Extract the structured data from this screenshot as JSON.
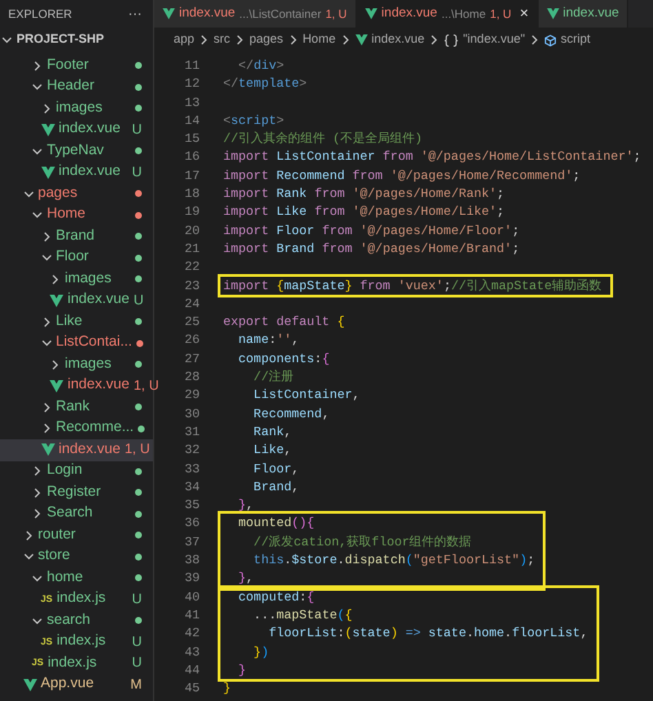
{
  "sidebar": {
    "title": "EXPLORER",
    "more": "···",
    "project": {
      "name": "PROJECT-SHP",
      "expanded": true
    }
  },
  "tree": {
    "cut_children": [
      {
        "name": "Footer",
        "kind": "folder",
        "expanded": false,
        "color": "#73c991",
        "selected": false
      },
      {
        "name": "Header",
        "kind": "folder",
        "expanded": true,
        "color": "#73c991",
        "selected": false,
        "children": [
          {
            "name": "images",
            "kind": "folder",
            "expanded": false,
            "color": "#73c991",
            "selected": false
          },
          {
            "name": "index.vue",
            "kind": "vue",
            "badge": "U",
            "color": "#73c991",
            "selected": false
          }
        ]
      },
      {
        "name": "TypeNav",
        "kind": "folder",
        "expanded": true,
        "color": "#73c991",
        "selected": false,
        "children": [
          {
            "name": "index.vue",
            "kind": "vue",
            "badge": "U",
            "color": "#73c991",
            "selected": false
          }
        ]
      }
    ],
    "items": [
      {
        "name": "pages",
        "kind": "folder",
        "expanded": true,
        "color": "#f07b6e",
        "selected": false,
        "children": [
          {
            "name": "Home",
            "kind": "folder",
            "expanded": true,
            "color": "#f07b6e",
            "selected": false,
            "children": [
              {
                "name": "Brand",
                "kind": "folder",
                "expanded": false,
                "color": "#73c991",
                "selected": false
              },
              {
                "name": "Floor",
                "kind": "folder",
                "expanded": true,
                "color": "#73c991",
                "selected": false,
                "children": [
                  {
                    "name": "images",
                    "kind": "folder",
                    "expanded": false,
                    "color": "#73c991",
                    "selected": false
                  },
                  {
                    "name": "index.vue",
                    "kind": "vue",
                    "badge": "U",
                    "color": "#73c991",
                    "selected": false
                  }
                ]
              },
              {
                "name": "Like",
                "kind": "folder",
                "expanded": false,
                "color": "#73c991",
                "selected": false
              },
              {
                "name": "ListContai...",
                "kind": "folder",
                "expanded": true,
                "color": "#f07b6e",
                "selected": false,
                "children": [
                  {
                    "name": "images",
                    "kind": "folder",
                    "expanded": false,
                    "color": "#73c991",
                    "selected": false
                  },
                  {
                    "name": "index.vue",
                    "kind": "vue",
                    "badge": "1, U",
                    "color": "#f07b6e",
                    "selected": false
                  }
                ]
              },
              {
                "name": "Rank",
                "kind": "folder",
                "expanded": false,
                "color": "#73c991",
                "selected": false
              },
              {
                "name": "Recomme...",
                "kind": "folder",
                "expanded": false,
                "color": "#73c991",
                "selected": false
              },
              {
                "name": "index.vue",
                "kind": "vue",
                "badge": "1, U",
                "color": "#f07b6e",
                "selected": true
              }
            ]
          },
          {
            "name": "Login",
            "kind": "folder",
            "expanded": false,
            "color": "#73c991",
            "selected": false
          },
          {
            "name": "Register",
            "kind": "folder",
            "expanded": false,
            "color": "#73c991",
            "selected": false
          },
          {
            "name": "Search",
            "kind": "folder",
            "expanded": false,
            "color": "#73c991",
            "selected": false
          }
        ]
      },
      {
        "name": "router",
        "kind": "folder",
        "expanded": false,
        "color": "#73c991",
        "selected": false
      },
      {
        "name": "store",
        "kind": "folder",
        "expanded": true,
        "color": "#73c991",
        "selected": false,
        "children": [
          {
            "name": "home",
            "kind": "folder",
            "expanded": true,
            "color": "#73c991",
            "selected": false,
            "children": [
              {
                "name": "index.js",
                "kind": "js",
                "icon_label": "JS",
                "badge": "U",
                "color": "#73c991",
                "selected": false
              }
            ]
          },
          {
            "name": "search",
            "kind": "folder",
            "expanded": true,
            "color": "#73c991",
            "selected": false,
            "children": [
              {
                "name": "index.js",
                "kind": "js",
                "icon_label": "JS",
                "badge": "U",
                "color": "#73c991",
                "selected": false
              }
            ]
          },
          {
            "name": "index.js",
            "kind": "js",
            "icon_label": "JS",
            "badge": "U",
            "color": "#73c991",
            "selected": false
          }
        ]
      },
      {
        "name": "App.vue",
        "kind": "vue",
        "badge": "M",
        "color": "#e2c08d",
        "selected": false
      }
    ]
  },
  "tabs": [
    {
      "filename": "index.vue",
      "path": "...\\ListContainer",
      "badge": "1, U",
      "color": "#f07b6e",
      "selected": false
    },
    {
      "filename": "index.vue",
      "path": "...\\Home",
      "badge": "1, U",
      "color": "#f07b6e",
      "selected": true,
      "close": "×"
    },
    {
      "filename": "index.vue",
      "color": "#73c991",
      "selected": false
    }
  ],
  "breadcrumb": [
    {
      "label": "app",
      "kind": "text"
    },
    {
      "label": "src",
      "kind": "text"
    },
    {
      "label": "pages",
      "kind": "text"
    },
    {
      "label": "Home",
      "kind": "text"
    },
    {
      "label": "index.vue",
      "kind": "vue"
    },
    {
      "label": "\"index.vue\"",
      "kind": "braces"
    },
    {
      "label": "script",
      "kind": "symbol"
    }
  ],
  "code": [
    {
      "boxed": false,
      "lines": [
        {
          "n": "11",
          "tokens": [
            {
              "t": "  </",
              "kind": "g"
            },
            {
              "t": "div",
              "kind": "tg"
            },
            {
              "t": ">",
              "kind": "g"
            }
          ]
        },
        {
          "n": "12",
          "tokens": [
            {
              "t": "</",
              "kind": "g"
            },
            {
              "t": "template",
              "kind": "tg"
            },
            {
              "t": ">",
              "kind": "g"
            }
          ]
        },
        {
          "n": "13"
        },
        {
          "n": "14",
          "tokens": [
            {
              "t": "<",
              "kind": "g"
            },
            {
              "t": "script",
              "kind": "tg"
            },
            {
              "t": ">",
              "kind": "g"
            }
          ]
        },
        {
          "n": "15",
          "tokens": [
            {
              "t": "//引入其余的组件 (不是全局组件)",
              "kind": "c"
            }
          ]
        },
        {
          "n": "16",
          "tokens": [
            {
              "t": "import",
              "kind": "k"
            },
            {
              "t": " ListContainer ",
              "kind": "v"
            },
            {
              "t": "from",
              "kind": "k"
            },
            {
              "t": " '@/pages/Home/ListContainer'",
              "kind": "s"
            },
            {
              "t": ";",
              "kind": "p"
            }
          ]
        },
        {
          "n": "17",
          "tokens": [
            {
              "t": "import",
              "kind": "k"
            },
            {
              "t": " Recommend ",
              "kind": "v"
            },
            {
              "t": "from",
              "kind": "k"
            },
            {
              "t": " '@/pages/Home/Recommend'",
              "kind": "s"
            },
            {
              "t": ";",
              "kind": "p"
            }
          ]
        },
        {
          "n": "18",
          "tokens": [
            {
              "t": "import",
              "kind": "k"
            },
            {
              "t": " Rank ",
              "kind": "v"
            },
            {
              "t": "from",
              "kind": "k"
            },
            {
              "t": " '@/pages/Home/Rank'",
              "kind": "s"
            },
            {
              "t": ";",
              "kind": "p"
            }
          ]
        },
        {
          "n": "19",
          "tokens": [
            {
              "t": "import",
              "kind": "k"
            },
            {
              "t": " Like ",
              "kind": "v"
            },
            {
              "t": "from",
              "kind": "k"
            },
            {
              "t": " '@/pages/Home/Like'",
              "kind": "s"
            },
            {
              "t": ";",
              "kind": "p"
            }
          ]
        },
        {
          "n": "20",
          "tokens": [
            {
              "t": "import",
              "kind": "k"
            },
            {
              "t": " Floor ",
              "kind": "v"
            },
            {
              "t": "from",
              "kind": "k"
            },
            {
              "t": " '@/pages/Home/Floor'",
              "kind": "s"
            },
            {
              "t": ";",
              "kind": "p"
            }
          ]
        },
        {
          "n": "21",
          "tokens": [
            {
              "t": "import",
              "kind": "k"
            },
            {
              "t": " Brand ",
              "kind": "v"
            },
            {
              "t": "from",
              "kind": "k"
            },
            {
              "t": " '@/pages/Home/Brand'",
              "kind": "s"
            },
            {
              "t": ";",
              "kind": "p"
            }
          ]
        },
        {
          "n": "22"
        }
      ]
    },
    {
      "boxed": true,
      "lines": [
        {
          "n": "23",
          "tokens": [
            {
              "t": "import ",
              "kind": "k"
            },
            {
              "t": "{",
              "kind": "b1"
            },
            {
              "t": "mapState",
              "kind": "v"
            },
            {
              "t": "}",
              "kind": "b1"
            },
            {
              "t": " from",
              "kind": "k"
            },
            {
              "t": " 'vuex'",
              "kind": "s"
            },
            {
              "t": ";",
              "kind": "p"
            },
            {
              "t": "//引入mapState辅助函数",
              "kind": "c"
            }
          ]
        }
      ]
    },
    {
      "boxed": false,
      "lines": [
        {
          "n": "24"
        },
        {
          "n": "25",
          "tokens": [
            {
              "t": "export default",
              "kind": "k"
            },
            {
              "t": " {",
              "kind": "b1"
            }
          ]
        },
        {
          "n": "26",
          "tokens": [
            {
              "t": "  name",
              "kind": "v"
            },
            {
              "t": ":",
              "kind": "p"
            },
            {
              "t": "''",
              "kind": "s"
            },
            {
              "t": ",",
              "kind": "p"
            }
          ]
        },
        {
          "n": "27",
          "tokens": [
            {
              "t": "  components",
              "kind": "v"
            },
            {
              "t": ":",
              "kind": "p"
            },
            {
              "t": "{",
              "kind": "b2"
            }
          ]
        },
        {
          "n": "28",
          "tokens": [
            {
              "t": "    //注册",
              "kind": "c"
            }
          ]
        },
        {
          "n": "29",
          "tokens": [
            {
              "t": "    ListContainer",
              "kind": "v"
            },
            {
              "t": ",",
              "kind": "p"
            }
          ]
        },
        {
          "n": "30",
          "tokens": [
            {
              "t": "    Recommend",
              "kind": "v"
            },
            {
              "t": ",",
              "kind": "p"
            }
          ]
        },
        {
          "n": "31",
          "tokens": [
            {
              "t": "    Rank",
              "kind": "v"
            },
            {
              "t": ",",
              "kind": "p"
            }
          ]
        },
        {
          "n": "32",
          "tokens": [
            {
              "t": "    Like",
              "kind": "v"
            },
            {
              "t": ",",
              "kind": "p"
            }
          ]
        },
        {
          "n": "33",
          "tokens": [
            {
              "t": "    Floor",
              "kind": "v"
            },
            {
              "t": ",",
              "kind": "p"
            }
          ]
        },
        {
          "n": "34",
          "tokens": [
            {
              "t": "    Brand",
              "kind": "v"
            },
            {
              "t": ",",
              "kind": "p"
            }
          ]
        },
        {
          "n": "35",
          "tokens": [
            {
              "t": "  }",
              "kind": "b2"
            },
            {
              "t": ",",
              "kind": "p"
            }
          ]
        }
      ]
    },
    {
      "boxed": true,
      "lines": [
        {
          "n": "36",
          "tokens": [
            {
              "t": "  mounted",
              "kind": "f"
            },
            {
              "t": "(){",
              "kind": "b2"
            }
          ]
        },
        {
          "n": "37",
          "tokens": [
            {
              "t": "    //派发cation,获取floor组件的数据",
              "kind": "c"
            }
          ]
        },
        {
          "n": "38",
          "tokens": [
            {
              "t": "    this",
              "kind": "tg"
            },
            {
              "t": ".",
              "kind": "p"
            },
            {
              "t": "$store",
              "kind": "v"
            },
            {
              "t": ".",
              "kind": "p"
            },
            {
              "t": "dispatch",
              "kind": "f"
            },
            {
              "t": "(",
              "kind": "b3"
            },
            {
              "t": "\"getFloorList\"",
              "kind": "s"
            },
            {
              "t": ")",
              "kind": "b3"
            },
            {
              "t": ";",
              "kind": "p"
            }
          ]
        },
        {
          "n": "39",
          "tokens": [
            {
              "t": "  }",
              "kind": "b2"
            },
            {
              "t": ",",
              "kind": "p"
            }
          ]
        }
      ]
    },
    {
      "boxed": true,
      "lines": [
        {
          "n": "40",
          "tokens": [
            {
              "t": "  computed",
              "kind": "v"
            },
            {
              "t": ":",
              "kind": "p"
            },
            {
              "t": "{",
              "kind": "b2"
            }
          ]
        },
        {
          "n": "41",
          "tokens": [
            {
              "t": "    ...",
              "kind": "p"
            },
            {
              "t": "mapState",
              "kind": "f"
            },
            {
              "t": "(",
              "kind": "b3"
            },
            {
              "t": "{",
              "kind": "b1"
            }
          ]
        },
        {
          "n": "42",
          "tokens": [
            {
              "t": "      floorList",
              "kind": "v"
            },
            {
              "t": ":",
              "kind": "p"
            },
            {
              "t": "(",
              "kind": "b1"
            },
            {
              "t": "state",
              "kind": "v"
            },
            {
              "t": ")",
              "kind": "b1"
            },
            {
              "t": " => ",
              "kind": "tg"
            },
            {
              "t": "state",
              "kind": "v"
            },
            {
              "t": ".",
              "kind": "p"
            },
            {
              "t": "home",
              "kind": "v"
            },
            {
              "t": ".",
              "kind": "p"
            },
            {
              "t": "floorList",
              "kind": "v"
            },
            {
              "t": ",",
              "kind": "p"
            }
          ]
        },
        {
          "n": "43",
          "tokens": [
            {
              "t": "    }",
              "kind": "b1"
            },
            {
              "t": ")",
              "kind": "b3"
            }
          ]
        },
        {
          "n": "44",
          "tokens": [
            {
              "t": "  }",
              "kind": "b2"
            }
          ]
        }
      ]
    },
    {
      "boxed": false,
      "lines": [
        {
          "n": "45",
          "tokens": [
            {
              "t": "}",
              "kind": "b1"
            }
          ]
        }
      ]
    }
  ]
}
